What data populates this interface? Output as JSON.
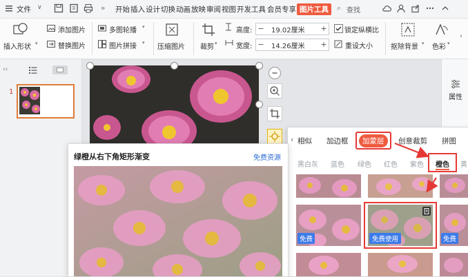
{
  "menubar": {
    "file_label": "文件",
    "tabs": [
      "开始",
      "插入",
      "设计",
      "切换",
      "动画",
      "放映",
      "审阅",
      "视图",
      "开发工具",
      "会员专享"
    ],
    "active_tab": "图片工具",
    "search_label": "查找",
    "overflow": "»"
  },
  "ribbon": {
    "insert_shape": "插入形状",
    "add_picture": "添加图片",
    "replace_picture": "替换图片",
    "multi_carousel": "多图轮播",
    "picture_splice": "图片拼接",
    "compress_picture": "压缩图片",
    "crop": "裁剪",
    "height_label": "高度:",
    "height_value": "19.02厘米",
    "width_label": "宽度:",
    "width_value": "14.26厘米",
    "lock_ratio": "锁定纵横比",
    "reset_size": "重设大小",
    "remove_bg": "抠除背景",
    "color": "色彩",
    "minus": "−",
    "plus": "+"
  },
  "slides": {
    "number": "1"
  },
  "props": {
    "label": "属性"
  },
  "pic_panel": {
    "tabs": [
      "相似",
      "加边框",
      "加蒙层",
      "创意裁剪",
      "拼图"
    ],
    "active_tab_index": 2,
    "color_tabs": [
      "黑白灰",
      "蓝色",
      "绿色",
      "红色",
      "紫色",
      "橙色",
      "黄"
    ],
    "active_color_index": 5,
    "free_badge": "免费",
    "free_use": "免费使用"
  },
  "preview": {
    "title": "绿橙从右下角矩形渐变",
    "source": "免费资源"
  },
  "colors": {
    "accent": "#ef5b3f",
    "link": "#2f6ed6",
    "badge": "#3d7bea",
    "annotation": "#e53935"
  }
}
